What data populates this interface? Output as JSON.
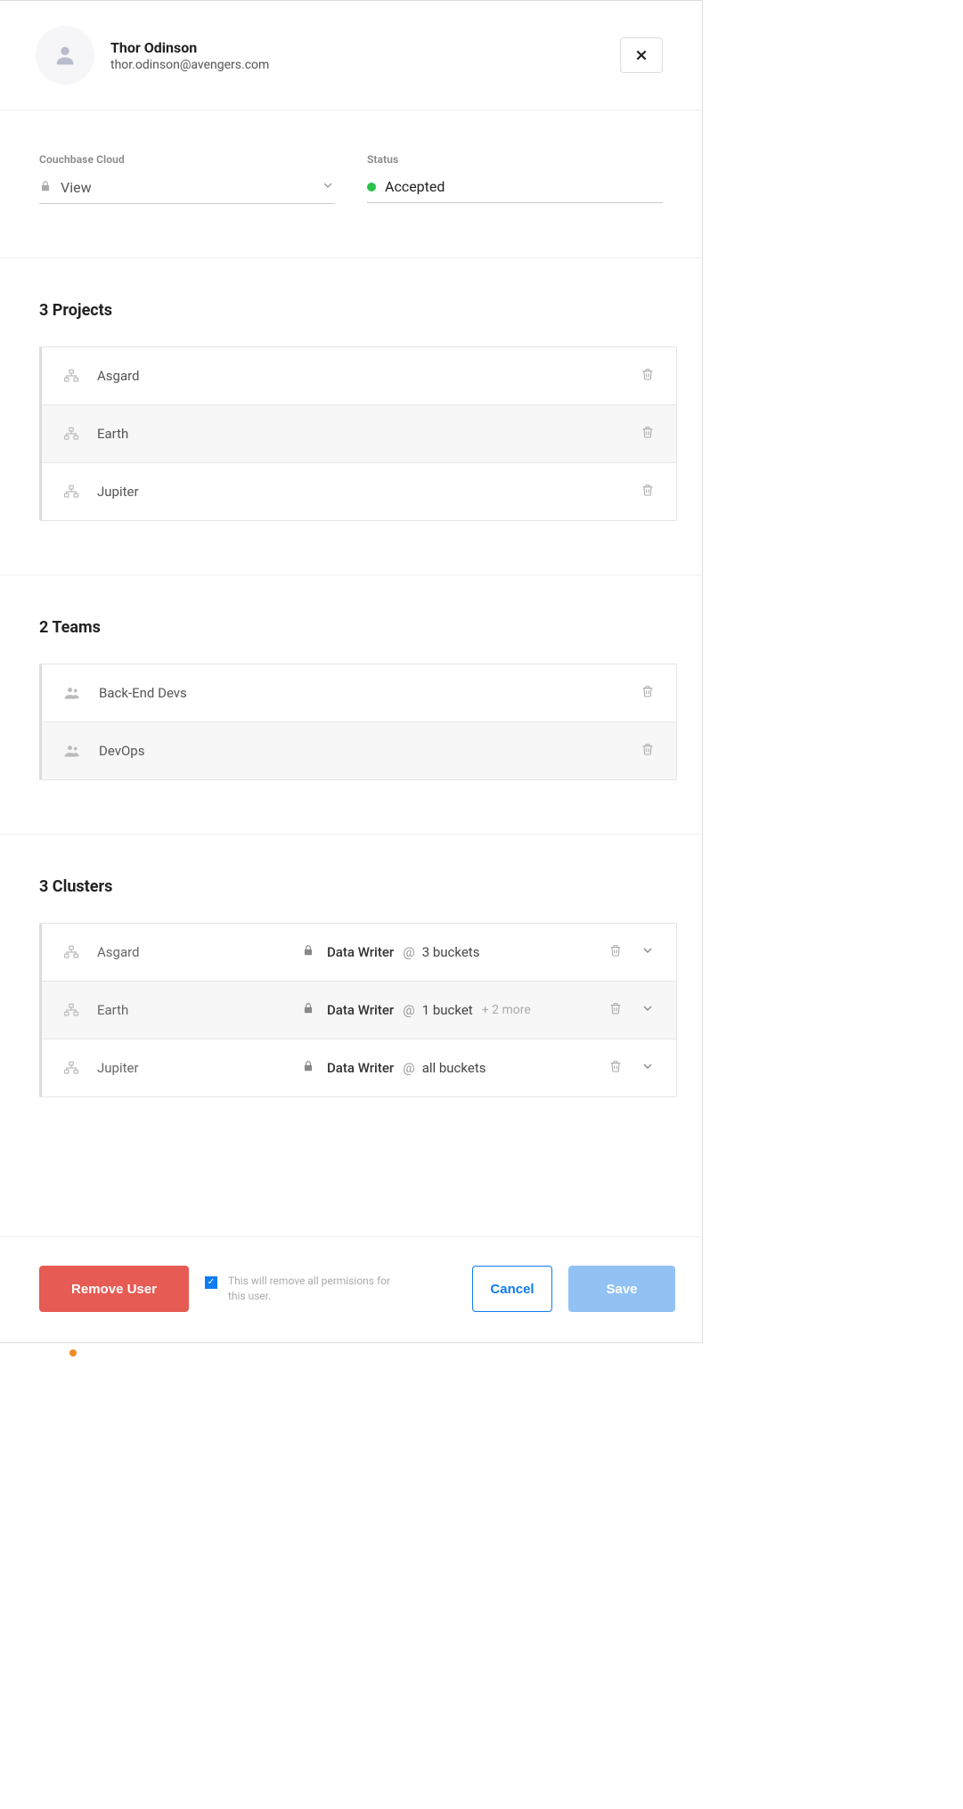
{
  "header": {
    "name": "Thor Odinson",
    "email": "thor.odinson@avengers.com"
  },
  "fields": {
    "cloud_label": "Couchbase Cloud",
    "cloud_value": "View",
    "status_label": "Status",
    "status_value": "Accepted"
  },
  "projects": {
    "title": "3 Projects",
    "items": [
      {
        "name": "Asgard",
        "alt": false
      },
      {
        "name": "Earth",
        "alt": true
      },
      {
        "name": "Jupiter",
        "alt": false
      }
    ]
  },
  "teams": {
    "title": "2 Teams",
    "items": [
      {
        "name": "Back-End Devs",
        "alt": false
      },
      {
        "name": "DevOps",
        "alt": true
      }
    ]
  },
  "clusters": {
    "title": "3 Clusters",
    "items": [
      {
        "name": "Asgard",
        "role": "Data Writer",
        "at": "@",
        "buckets": "3 buckets",
        "more": "",
        "alt": false
      },
      {
        "name": "Earth",
        "role": "Data Writer",
        "at": "@",
        "buckets": "1 bucket",
        "more": "+ 2 more",
        "alt": true
      },
      {
        "name": "Jupiter",
        "role": "Data Writer",
        "at": "@",
        "buckets": "all buckets",
        "more": "",
        "alt": false
      }
    ]
  },
  "footer": {
    "remove": "Remove User",
    "confirm_text": "This will remove all permisions for this user.",
    "cancel": "Cancel",
    "save": "Save"
  }
}
